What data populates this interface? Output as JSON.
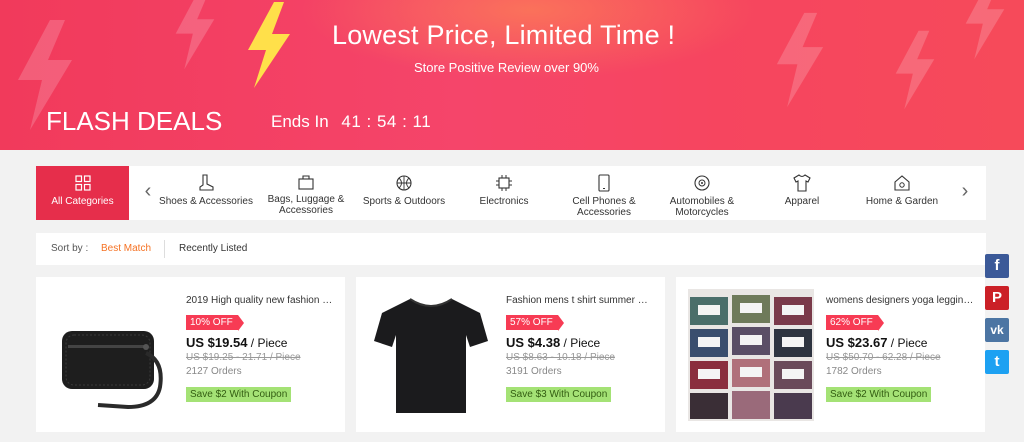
{
  "banner": {
    "headline": "Lowest Price, Limited Time !",
    "subline": "Store Positive Review over 90%",
    "flash_title": "FLASH DEALS",
    "ends_label": "Ends In",
    "timer": "41 : 54 : 11"
  },
  "categories": {
    "all_label": "All Categories",
    "items": [
      {
        "label": "Shoes & Accessories",
        "icon": "boot-icon"
      },
      {
        "label": "Bags, Luggage & Accessories",
        "icon": "bag-icon"
      },
      {
        "label": "Sports & Outdoors",
        "icon": "ball-icon"
      },
      {
        "label": "Electronics",
        "icon": "chip-icon"
      },
      {
        "label": "Cell Phones & Accessories",
        "icon": "phone-icon"
      },
      {
        "label": "Automobiles & Motorcycles",
        "icon": "wheel-icon"
      },
      {
        "label": "Apparel",
        "icon": "shirt-icon"
      },
      {
        "label": "Home & Garden",
        "icon": "house-icon"
      }
    ]
  },
  "sort": {
    "label": "Sort by :",
    "best_match": "Best Match",
    "recently_listed": "Recently Listed"
  },
  "products": [
    {
      "title": "2019 High quality new fashion m...",
      "discount": "10% OFF",
      "price": "US $19.54",
      "unit": " / Piece",
      "old_price": "US $19.25 - 21.71 / Piece",
      "orders": "2127 Orders",
      "coupon": "Save $2 With Coupon"
    },
    {
      "title": "Fashion mens t shirt summer Sh...",
      "discount": "57% OFF",
      "price": "US $4.38",
      "unit": " / Piece",
      "old_price": "US $8.63 - 10.18 / Piece",
      "orders": "3191 Orders",
      "coupon": "Save $3 With Coupon"
    },
    {
      "title": "womens designers yoga leggings...",
      "discount": "62% OFF",
      "price": "US $23.67",
      "unit": " / Piece",
      "old_price": "US $50.70 - 62.28 / Piece",
      "orders": "1782 Orders",
      "coupon": "Save $2 With Coupon"
    }
  ],
  "social": [
    {
      "name": "facebook",
      "glyph": "f",
      "color": "#3b5998"
    },
    {
      "name": "pinterest",
      "glyph": "P",
      "color": "#cb2027"
    },
    {
      "name": "vk",
      "glyph": "vk",
      "color": "#4c75a3"
    },
    {
      "name": "twitter",
      "glyph": "t",
      "color": "#1da1f2"
    }
  ],
  "colors": {
    "accent": "#e62e4b",
    "discount": "#f73b54",
    "coupon": "#a4e275",
    "sort_active": "#f57224"
  }
}
